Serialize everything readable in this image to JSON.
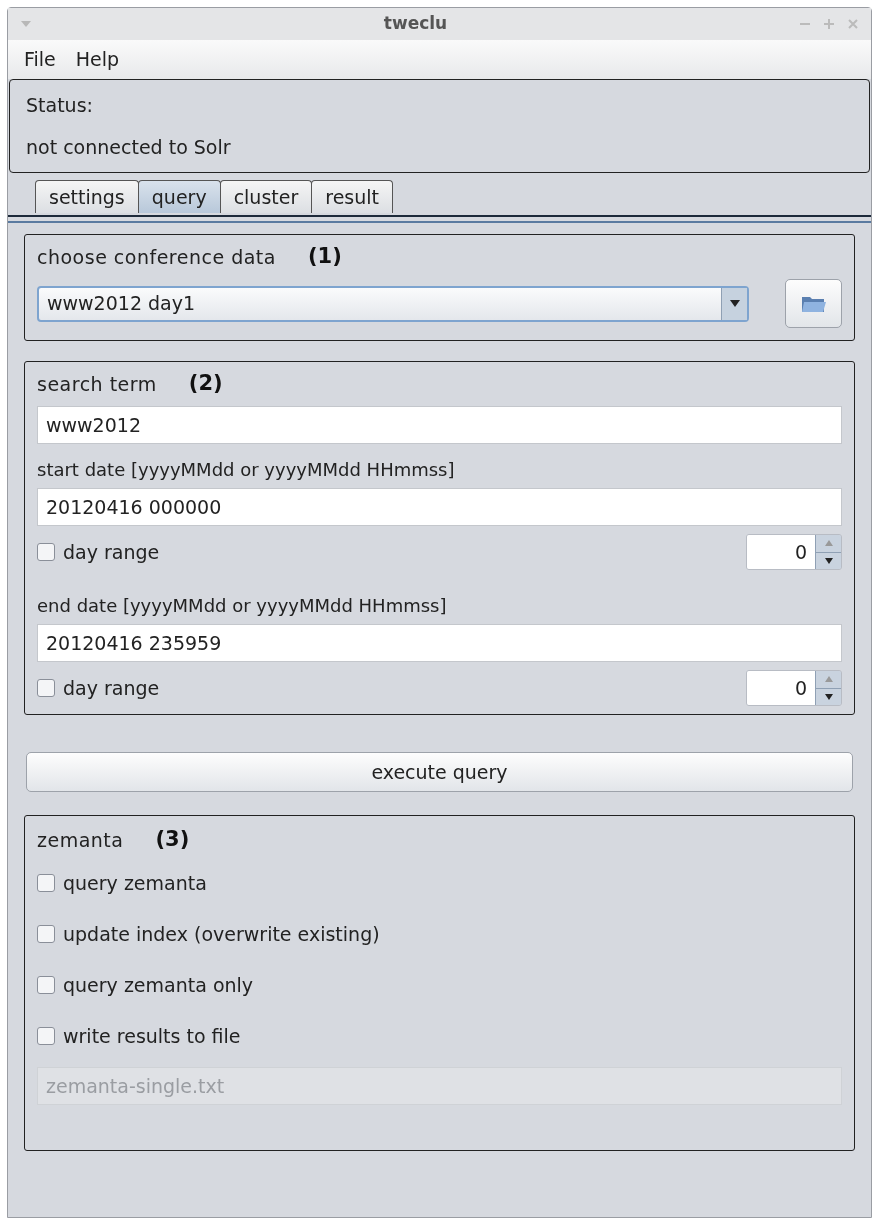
{
  "window": {
    "title": "tweclu"
  },
  "menu": [
    "File",
    "Help"
  ],
  "status": {
    "label": "Status:",
    "message": "not connected to Solr"
  },
  "tabs": [
    {
      "label": "settings",
      "selected": false
    },
    {
      "label": "query",
      "selected": true
    },
    {
      "label": "cluster",
      "selected": false
    },
    {
      "label": "result",
      "selected": false
    }
  ],
  "conference": {
    "title": "choose conference data",
    "number": "(1)",
    "selection": "www2012 day1"
  },
  "search": {
    "title": "search term",
    "number": "(2)",
    "term": "www2012",
    "start": {
      "label": "start date [yyyyMMdd or yyyyMMdd HHmmss]",
      "value": "20120416 000000",
      "range_label": "day range",
      "range_checked": false,
      "range_value": "0"
    },
    "end": {
      "label": "end date [yyyyMMdd or yyyyMMdd HHmmss]",
      "value": "20120416 235959",
      "range_label": "day range",
      "range_checked": false,
      "range_value": "0"
    }
  },
  "execute_button": "execute query",
  "zemanta": {
    "title": "zemanta",
    "number": "(3)",
    "options": [
      {
        "label": "query zemanta",
        "checked": false
      },
      {
        "label": "update index (overwrite existing)",
        "checked": false
      },
      {
        "label": "query zemanta only",
        "checked": false
      },
      {
        "label": "write results to file",
        "checked": false
      }
    ],
    "file": {
      "value": "zemanta-single.txt",
      "disabled": true
    }
  }
}
